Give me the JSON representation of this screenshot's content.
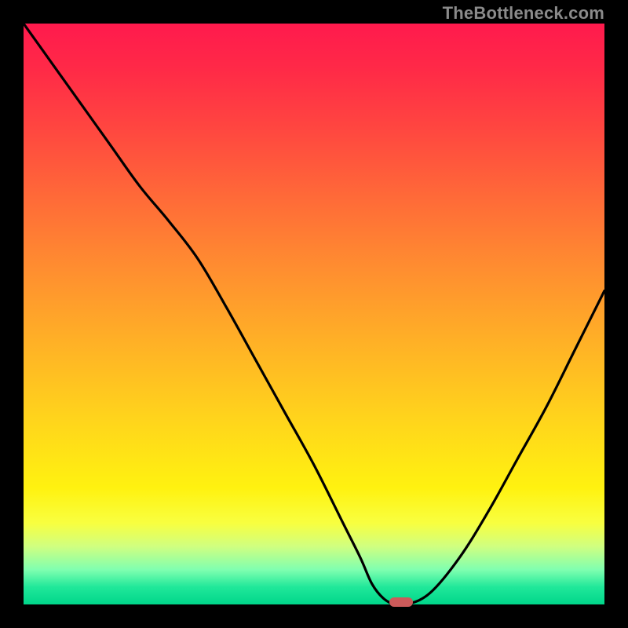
{
  "watermark": "TheBottleneck.com",
  "colors": {
    "frame": "#000000",
    "curve": "#000000",
    "marker": "#cc5a5a",
    "gradient_top": "#ff1a4d",
    "gradient_bottom": "#00d68a"
  },
  "chart_data": {
    "type": "line",
    "title": "",
    "xlabel": "",
    "ylabel": "",
    "xlim": [
      0,
      100
    ],
    "ylim": [
      0,
      100
    ],
    "grid": false,
    "x": [
      0,
      5,
      10,
      15,
      20,
      25,
      30,
      35,
      40,
      45,
      50,
      55,
      58,
      60,
      62,
      64,
      66,
      70,
      75,
      80,
      85,
      90,
      95,
      100
    ],
    "values": [
      100,
      93,
      86,
      79,
      72,
      66,
      59.5,
      51,
      42,
      33,
      24,
      14,
      8,
      3.5,
      1,
      0,
      0,
      2,
      8,
      16,
      25,
      34,
      44,
      54
    ],
    "curve_minimum": {
      "x": 65,
      "y": 0
    },
    "annotations": [
      {
        "kind": "min-marker",
        "x": 65,
        "y": 0,
        "color": "#cc5a5a"
      }
    ]
  }
}
